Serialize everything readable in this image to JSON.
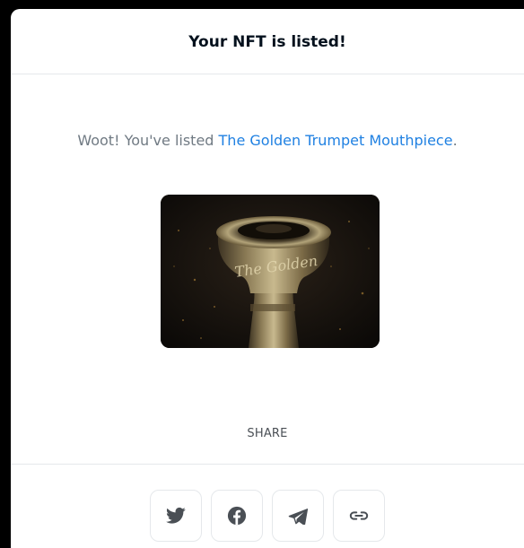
{
  "modal": {
    "title": "Your NFT is listed!",
    "message_prefix": "Woot! You've listed ",
    "nft_name": "The Golden Trumpet Mouthpiece",
    "message_suffix": ".",
    "image_engraving": "The Golden",
    "share_label": "SHARE",
    "share_buttons": [
      {
        "icon": "twitter-icon"
      },
      {
        "icon": "facebook-icon"
      },
      {
        "icon": "telegram-icon"
      },
      {
        "icon": "link-icon"
      }
    ]
  },
  "colors": {
    "link": "#2081e2",
    "icon": "#4a4f55",
    "border": "#e5e8eb"
  }
}
